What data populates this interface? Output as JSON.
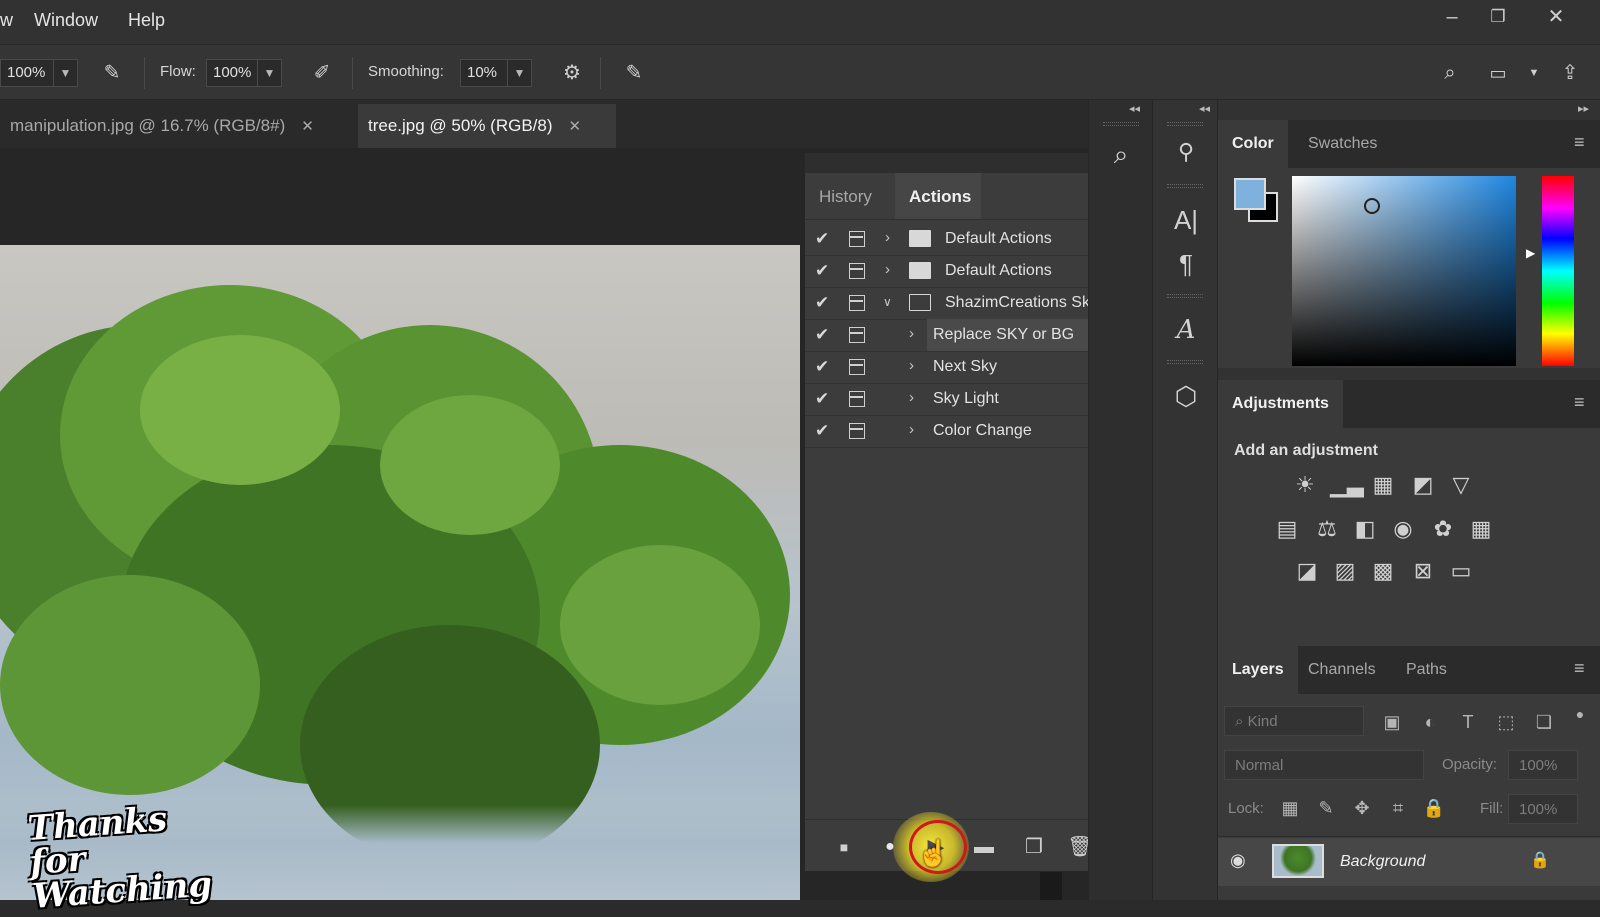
{
  "menubar": {
    "items": [
      "w",
      "Window",
      "Help"
    ],
    "minimize": "–",
    "restore": "❐",
    "close": "✕"
  },
  "options": {
    "opacity_value": "100%",
    "flow_label": "Flow:",
    "flow_value": "100%",
    "smoothing_label": "Smoothing:",
    "smoothing_value": "10%"
  },
  "doc_tabs": [
    {
      "label": "manipulation.jpg @ 16.7% (RGB/8#)",
      "close": "✕"
    },
    {
      "label": "tree.jpg @ 50% (RGB/8)",
      "close": "✕"
    }
  ],
  "actions_panel": {
    "tabs": [
      "History",
      "Actions"
    ],
    "active_tab": "Actions",
    "rows": [
      {
        "label": "Default Actions",
        "level": 0,
        "expanded": false
      },
      {
        "label": "Default Actions",
        "level": 0,
        "expanded": false
      },
      {
        "label": "ShazimCreations Sk...",
        "level": 0,
        "expanded": true
      },
      {
        "label": "Replace SKY or BG",
        "level": 1,
        "selected": true
      },
      {
        "label": "Next Sky",
        "level": 1
      },
      {
        "label": "Sky Light",
        "level": 1
      },
      {
        "label": "Color Change",
        "level": 1
      }
    ]
  },
  "color_panel": {
    "tabs": [
      "Color",
      "Swatches"
    ],
    "foreground": "#7fb1de",
    "background": "#000000",
    "hue": "#1f86e0"
  },
  "adjustments_panel": {
    "tab": "Adjustments",
    "add_label": "Add an adjustment"
  },
  "layers_panel": {
    "tabs": [
      "Layers",
      "Channels",
      "Paths"
    ],
    "kind_placeholder": "Kind",
    "blend_mode": "Normal",
    "opacity_label": "Opacity:",
    "opacity_value": "100%",
    "lock_label": "Lock:",
    "fill_label": "Fill:",
    "fill_value": "100%",
    "layer_name": "Background"
  },
  "overlay": {
    "thanks_line1": "Thanks for",
    "thanks_line2": "Watching"
  }
}
